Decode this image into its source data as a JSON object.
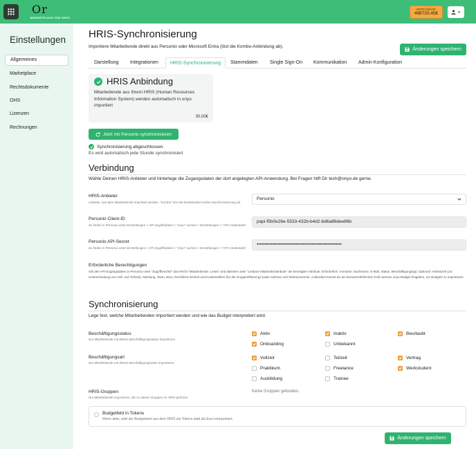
{
  "topbar": {
    "logo_mark": "Or",
    "logo_sub": "MARKETPLACE VON ONYO",
    "balance_label": "VERFÜGBAR:",
    "balance_value": "498720,45€"
  },
  "sidebar": {
    "title": "Einstellungen",
    "items": [
      {
        "label": "Allgemeines"
      },
      {
        "label": "Marketplace"
      },
      {
        "label": "Rechtsdokumente"
      },
      {
        "label": "OHS"
      },
      {
        "label": "Lizenzen"
      },
      {
        "label": "Rechnungen"
      }
    ]
  },
  "header": {
    "title": "HRIS-Synchronisierung",
    "subtitle": "Importiere Mitarbeitende direkt aus Personio oder Microsoft Entra (löst die Kombo-Anbindung ab).",
    "save_label": "Änderungen speichern"
  },
  "tabs": [
    {
      "label": "Darstellung"
    },
    {
      "label": "Integrationen"
    },
    {
      "label": "HRIS-Synchronisierung"
    },
    {
      "label": "Stammdaten"
    },
    {
      "label": "Single Sign-On"
    },
    {
      "label": "Kommunikation"
    },
    {
      "label": "Admin Konfiguration"
    }
  ],
  "hris_card": {
    "title": "HRIS Anbindung",
    "description": "Mitarbeitende aus Ihrem HRIS (Human Resources Information System) werden automatisch in onyo importiert",
    "price": "30,00€"
  },
  "sync": {
    "button_label": "Jetzt mit Personio synchronisieren",
    "status": "Synchronisierung abgeschlossen",
    "note": "Es wird automatisch jede Stunde synchronisiert"
  },
  "connection": {
    "title": "Verbindung",
    "subtitle": "Wähle Deinen HRIS-Anbieter und hinterlege die Zugangsdaten der dort angelegten API-Anwendung. Bei Fragen hilft Dir tech@onyo.de gerne.",
    "provider_label": "HRIS-Anbieter",
    "provider_help": "Anbieter, aus dem Mitarbeitende importiert werden. \"Kombo\" löst die bestehende Kombo-Synchronisierung ab.",
    "provider_value": "Personio",
    "client_id_label": "Personio Client-ID",
    "client_id_help": "Zu finden in Personio unter Einstellungen > API-Zugriffsdaten > \"onyo\" suchen > Einstellungen > \"API Credentials\".",
    "client_id_value": "papi-f5b0e26e-5533-432b-b4d2-bd6a86dee86b",
    "secret_label": "Personio API-Secret",
    "secret_help": "Zu finden in Personio unter Einstellungen > API-Zugriffsdaten > \"onyo\" suchen > Einstellungen > \"API Credentials\".",
    "secret_value": "••••••••••••••••••••••••••••••••••••••••••••••••••••••",
    "perm_label": "Erforderliche Berechtigungen",
    "perm_text": "Gib den API-Zugangsdaten in Personio unter \"Zugriffsrechte\" das Recht \"Mitarbeitende: Lesen\" und aktiviere unter \"Lesbare Mitarbeiterattribute\" die benötigten Attribute: Erforderlich: Vorname, Nachname, E-Mail, Status, Beschäftigungstyp; Optional: Arbeitszeit (zur Unterscheidung von Voll- und Teilzeit), Abteilung, Team, Büro, Rechtliche Einheit und Kostenstellen (für die Gruppenfilterung) sowie Adresse und Telefonnummer. Außerdem kannst Du ein benutzerdefiniertes Feld namens onyo-Budget freigeben, um Budgets zu importieren."
  },
  "synchronisation": {
    "title": "Synchronisierung",
    "subtitle": "Lege fest, welche Mitarbeitenden importiert werden und wie das Budget interpretiert wird.",
    "status_label": "Beschäftigungsstatus",
    "status_help": "Nur Mitarbeitende mit diesen Beschäftigungsstatus importieren.",
    "status_options": [
      {
        "label": "Aktiv",
        "checked": true
      },
      {
        "label": "Inaktiv",
        "checked": true
      },
      {
        "label": "Beurlaubt",
        "checked": true
      },
      {
        "label": "Onboarding",
        "checked": true
      },
      {
        "label": "Unbekannt",
        "checked": false
      }
    ],
    "type_label": "Beschäftigungsart",
    "type_help": "Nur Mitarbeitende mit diesen Beschäftigungsarten importieren.",
    "type_options": [
      {
        "label": "Vollzeit",
        "checked": true
      },
      {
        "label": "Teilzeit",
        "checked": false
      },
      {
        "label": "Vertrag",
        "checked": true
      },
      {
        "label": "Praktikum",
        "checked": false
      },
      {
        "label": "Freelance",
        "checked": false
      },
      {
        "label": "Werkstudent",
        "checked": true
      },
      {
        "label": "Ausbildung",
        "checked": false
      },
      {
        "label": "Trainee",
        "checked": false
      }
    ],
    "groups_label": "HRIS-Gruppen",
    "groups_help": "Nur Mitarbeitende importieren, die zu diesen Gruppen im HRIS gehören.",
    "groups_empty": "Keine Gruppen gefunden.",
    "budget_label": "Budgetfeld in Tokens",
    "budget_help": "Wenn aktiv, wird der Budgetwert aus dem HRIS als Tokens statt als Euro interpretiert."
  },
  "colors": {
    "brand": "#3ebd79",
    "button": "#2fb36f",
    "accent": "#f4a942"
  }
}
